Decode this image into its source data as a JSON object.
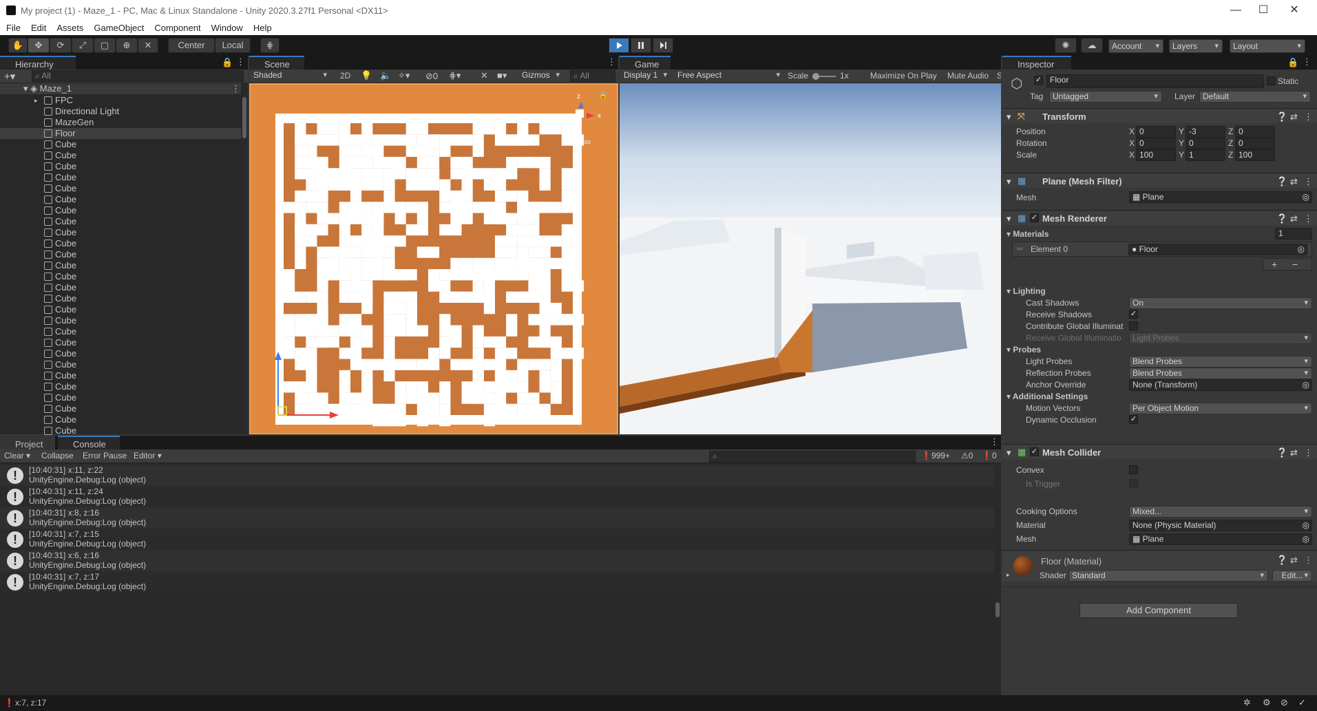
{
  "window": {
    "title": "My project (1) - Maze_1 - PC, Mac & Linux Standalone - Unity 2020.3.27f1 Personal <DX11>"
  },
  "menu": [
    "File",
    "Edit",
    "Assets",
    "GameObject",
    "Component",
    "Window",
    "Help"
  ],
  "toolbar": {
    "center_label": "Center",
    "local_label": "Local",
    "account_label": "Account",
    "layers_label": "Layers",
    "layout_label": "Layout"
  },
  "hierarchy": {
    "tab": "Hierarchy",
    "search_placeholder": "All",
    "scene": "Maze_1",
    "items": [
      "FPC",
      "Directional Light",
      "MazeGen",
      "Floor",
      "Cube",
      "Cube",
      "Cube",
      "Cube",
      "Cube",
      "Cube",
      "Cube",
      "Cube",
      "Cube",
      "Cube",
      "Cube",
      "Cube",
      "Cube",
      "Cube",
      "Cube",
      "Cube",
      "Cube",
      "Cube",
      "Cube",
      "Cube",
      "Cube",
      "Cube",
      "Cube",
      "Cube",
      "Cube",
      "Cube",
      "Cube",
      "Cube"
    ],
    "selected": "Floor"
  },
  "scene": {
    "tab": "Scene",
    "shading": "Shaded",
    "mode_2d": "2D",
    "hidden_count": "0",
    "gizmos": "Gizmos",
    "search_placeholder": "All",
    "persp_label": "Iso",
    "gizmo_z": "z",
    "gizmo_x": "x"
  },
  "game": {
    "tab": "Game",
    "display": "Display 1",
    "aspect": "Free Aspect",
    "scale_label": "Scale",
    "scale_value": "1x",
    "maximize": "Maximize On Play",
    "mute": "Mute Audio",
    "stats": "S"
  },
  "inspector": {
    "tab": "Inspector",
    "object_name": "Floor",
    "static_label": "Static",
    "tag_label": "Tag",
    "tag_value": "Untagged",
    "layer_label": "Layer",
    "layer_value": "Default",
    "transform": {
      "title": "Transform",
      "position": {
        "label": "Position",
        "x": "0",
        "y": "-3",
        "z": "0"
      },
      "rotation": {
        "label": "Rotation",
        "x": "0",
        "y": "0",
        "z": "0"
      },
      "scale": {
        "label": "Scale",
        "x": "100",
        "y": "1",
        "z": "100"
      }
    },
    "mesh_filter": {
      "title": "Plane (Mesh Filter)",
      "mesh_label": "Mesh",
      "mesh_value": "Plane"
    },
    "mesh_renderer": {
      "title": "Mesh Renderer",
      "materials_label": "Materials",
      "materials_count": "1",
      "element_label": "Element 0",
      "element_value": "Floor",
      "lighting_label": "Lighting",
      "cast_shadows_label": "Cast Shadows",
      "cast_shadows_value": "On",
      "receive_shadows_label": "Receive Shadows",
      "contribute_gi_label": "Contribute Global Illuminat",
      "receive_gi_label": "Receive Global Illuminatio",
      "receive_gi_value": "Light Probes",
      "probes_label": "Probes",
      "light_probes_label": "Light Probes",
      "light_probes_value": "Blend Probes",
      "reflection_probes_label": "Reflection Probes",
      "reflection_probes_value": "Blend Probes",
      "anchor_label": "Anchor Override",
      "anchor_value": "None (Transform)",
      "additional_label": "Additional Settings",
      "motion_vectors_label": "Motion Vectors",
      "motion_vectors_value": "Per Object Motion",
      "dynamic_occlusion_label": "Dynamic Occlusion"
    },
    "mesh_collider": {
      "title": "Mesh Collider",
      "convex_label": "Convex",
      "trigger_label": "Is Trigger",
      "cooking_label": "Cooking Options",
      "cooking_value": "Mixed...",
      "material_label": "Material",
      "material_value": "None (Physic Material)",
      "mesh_label": "Mesh",
      "mesh_value": "Plane"
    },
    "material": {
      "title": "Floor (Material)",
      "shader_label": "Shader",
      "shader_value": "Standard",
      "edit_label": "Edit..."
    },
    "add_component": "Add Component"
  },
  "bottom": {
    "tabs": [
      "Project",
      "Console"
    ],
    "clear": "Clear",
    "collapse": "Collapse",
    "error_pause": "Error Pause",
    "editor": "Editor",
    "log_count": "999+",
    "warn_count": "0",
    "error_count": "0",
    "logs": [
      {
        "line1": "[10:40:31] x:11, z:22",
        "line2": "UnityEngine.Debug:Log (object)"
      },
      {
        "line1": "[10:40:31] x:11, z:24",
        "line2": "UnityEngine.Debug:Log (object)"
      },
      {
        "line1": "[10:40:31] x:8, z:16",
        "line2": "UnityEngine.Debug:Log (object)"
      },
      {
        "line1": "[10:40:31] x:7, z:15",
        "line2": "UnityEngine.Debug:Log (object)"
      },
      {
        "line1": "[10:40:31] x:6, z:16",
        "line2": "UnityEngine.Debug:Log (object)"
      },
      {
        "line1": "[10:40:31] x:7, z:17",
        "line2": "UnityEngine.Debug:Log (object)"
      }
    ]
  },
  "statusbar": {
    "message": "x:7, z:17"
  },
  "colors": {
    "accent": "#3a79bb",
    "maze_floor": "#c9763a",
    "maze_wall": "#ffffff",
    "selection": "#2c5d87"
  }
}
